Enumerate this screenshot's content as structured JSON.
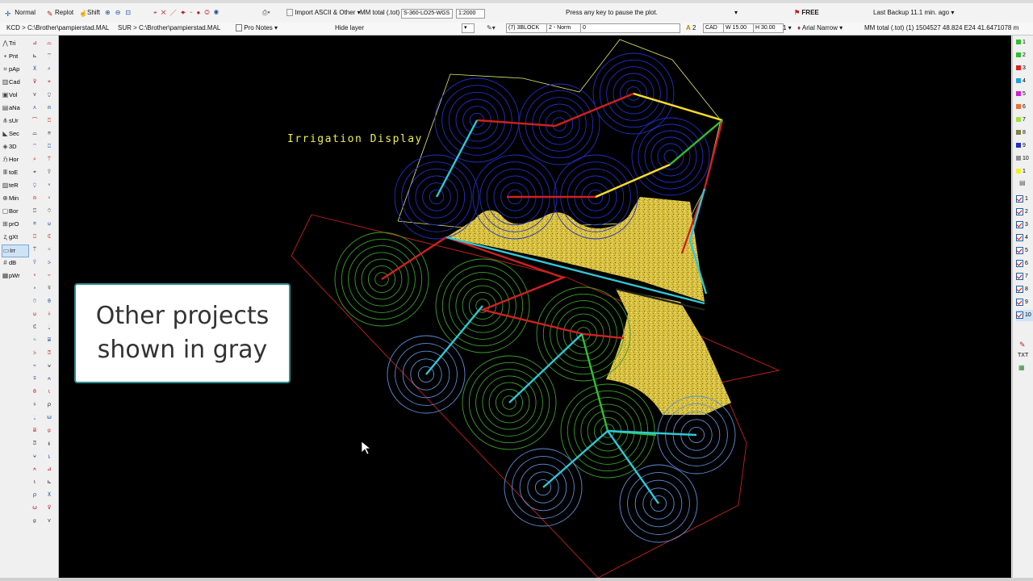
{
  "toolbar1": {
    "normal": "Normal",
    "replot": "Replot",
    "shift": "Shift",
    "import": "Import ASCII & Other",
    "mm_total": "MM total (.tot)",
    "coord_system": "S-360-LO25-WGS",
    "scale": "1:2000",
    "status_message": "Press any key to pause the plot.",
    "free": "FREE",
    "last_backup": "Last Backup 11.1 min. ago"
  },
  "toolbar2": {
    "kcd_path": "KCD > C:\\Brother\\pampierstad.MAL",
    "sur_path": "SUR > C:\\Brother\\pampierstad.MAL",
    "pro_notes": "Pro Notes",
    "hide_layer": "Hide layer",
    "block": "(7) 3BLOCK",
    "norm": "2 - Norm",
    "value_zero": "0",
    "text_size": "2",
    "cad": "CAD",
    "width": "W 15.00",
    "height": "H 30.00",
    "font_count": "1",
    "font": "Arial Narrow",
    "mm_total_readout": "MM total (.tot)   (1) 1504527 48.824 E24 41.6471078 m"
  },
  "left_tools": [
    {
      "icon": "triangle-icon",
      "label": "Tri"
    },
    {
      "icon": "point-icon",
      "label": "Pnt"
    },
    {
      "icon": "pap-icon",
      "label": "pAp"
    },
    {
      "icon": "cadastral-icon",
      "label": "Cad"
    },
    {
      "icon": "volume-icon",
      "label": "Vol"
    },
    {
      "icon": "nav-icon",
      "label": "aNa"
    },
    {
      "icon": "survey-icon",
      "label": "sUr"
    },
    {
      "icon": "section-icon",
      "label": "Sec"
    },
    {
      "icon": "3d-icon",
      "label": "3D"
    },
    {
      "icon": "horizontal-icon",
      "label": "Hor"
    },
    {
      "icon": "toe-icon",
      "label": "toE"
    },
    {
      "icon": "ter-icon",
      "label": "teR"
    },
    {
      "icon": "mine-icon",
      "label": "Min"
    },
    {
      "icon": "border-icon",
      "label": "Bor"
    },
    {
      "icon": "profile-icon",
      "label": "prO"
    },
    {
      "icon": "gxt-icon",
      "label": "gXt"
    },
    {
      "icon": "irrigation-icon",
      "label": "Irr"
    },
    {
      "icon": "db-icon",
      "label": "dB"
    },
    {
      "icon": "pwr-icon",
      "label": "pWr"
    }
  ],
  "layers": [
    {
      "num": "1",
      "color": "#2ec02e"
    },
    {
      "num": "2",
      "color": "#2ec02e"
    },
    {
      "num": "3",
      "color": "#e02020"
    },
    {
      "num": "4",
      "color": "#20a0e0"
    },
    {
      "num": "5",
      "color": "#d020d0"
    },
    {
      "num": "6",
      "color": "#f07030"
    },
    {
      "num": "7",
      "color": "#a0e040"
    },
    {
      "num": "8",
      "color": "#808040"
    },
    {
      "num": "9",
      "color": "#2030c0"
    },
    {
      "num": "10",
      "color": "#909090"
    },
    {
      "num": "1",
      "color": "#f0f020"
    }
  ],
  "layer_checks": [
    "1",
    "2",
    "3",
    "4",
    "5",
    "6",
    "7",
    "8",
    "9",
    "10"
  ],
  "canvas": {
    "label": "Irrigation Display"
  },
  "callout": {
    "line1": "Other projects",
    "line2": "shown in gray"
  }
}
